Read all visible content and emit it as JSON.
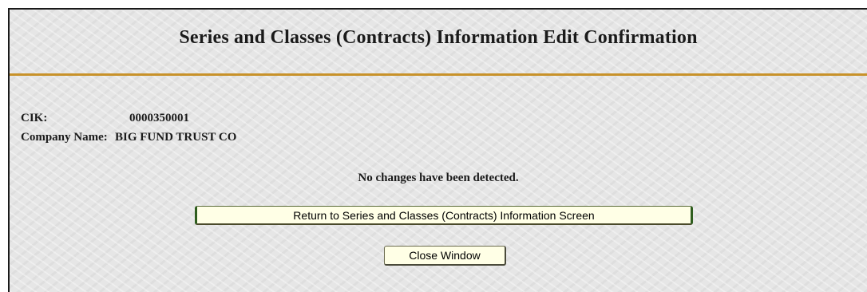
{
  "page": {
    "title": "Series and Classes (Contracts) Information Edit Confirmation"
  },
  "company": {
    "cik_label": "CIK:",
    "cik_value": "0000350001",
    "name_label": "Company Name:",
    "name_value": "BIG FUND TRUST CO"
  },
  "status": {
    "message": "No changes have been detected."
  },
  "actions": {
    "return_label": "Return to Series and Classes (Contracts) Information Screen",
    "close_label": "Close Window"
  },
  "colors": {
    "rule_accent": "#c8922a",
    "button_fill": "#ffffe6",
    "button_border_accent": "#2e5d1e"
  }
}
